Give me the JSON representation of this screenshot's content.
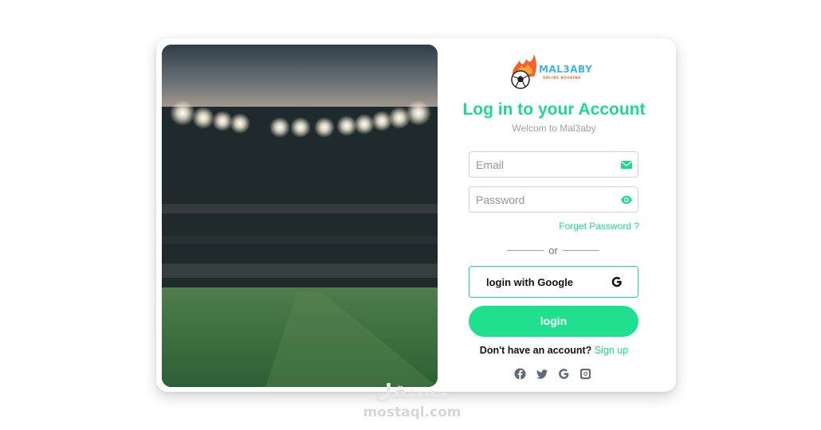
{
  "brand": {
    "name": "MAL3ABY",
    "tagline": "ONLINE BOOKING"
  },
  "header": {
    "title": "Log in to your Account",
    "subtitle": "Welcom to Mal3aby"
  },
  "form": {
    "email_placeholder": "Email",
    "email_value": "",
    "email_icon": "envelope-icon",
    "password_placeholder": "Password",
    "password_value": "",
    "password_icon": "eye-icon",
    "forget_label": "Forget Password ?",
    "or_label": "or",
    "google_label": "login with Google",
    "login_label": "login"
  },
  "signup": {
    "question": "Don't have an account?",
    "link": "Sign up"
  },
  "social_icons": [
    "facebook-icon",
    "twitter-icon",
    "google-icon",
    "instagram-icon"
  ],
  "watermark": {
    "arabic": "مستقل",
    "domain": "mostaql.com"
  },
  "colors": {
    "accent": "#1ed88f",
    "button": "#1ee08f",
    "muted": "#9aa0a6",
    "logo_blue": "#3fb4e8",
    "logo_orange": "#e86a2a"
  }
}
